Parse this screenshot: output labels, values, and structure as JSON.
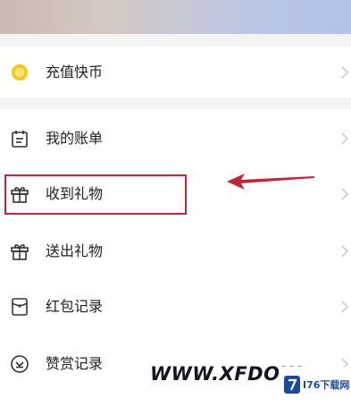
{
  "menu": {
    "recharge": {
      "label": "充值快币",
      "icon": "coin-icon"
    },
    "items": [
      {
        "label": "我的账单",
        "icon": "bill-icon"
      },
      {
        "label": "收到礼物",
        "icon": "gift-icon"
      },
      {
        "label": "送出礼物",
        "icon": "gift-icon"
      },
      {
        "label": "红包记录",
        "icon": "red-envelope-icon"
      },
      {
        "label": "赞赏记录",
        "icon": "appreciation-icon"
      }
    ]
  },
  "annotation": {
    "highlighted_item": "收到礼物",
    "highlight_color": "#c0283a"
  },
  "watermark": {
    "text": "WWW.XFDOW",
    "logo_text": "I76下载网"
  },
  "colors": {
    "coin": "#f5c518",
    "icon_stroke": "#333333",
    "text": "#222222",
    "chevron": "#cccccc",
    "background": "#f4f4f5"
  }
}
